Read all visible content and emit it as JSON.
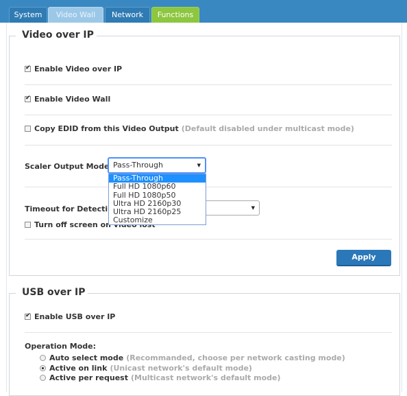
{
  "tabs": [
    {
      "label": "System"
    },
    {
      "label": "Video Wall"
    },
    {
      "label": "Network"
    },
    {
      "label": "Functions"
    }
  ],
  "video_over_ip": {
    "legend": "Video over IP",
    "enable_video_over_ip": {
      "label": "Enable Video over IP",
      "checked": true
    },
    "enable_video_wall": {
      "label": "Enable Video Wall",
      "checked": true
    },
    "copy_edid": {
      "label": "Copy EDID from this Video Output",
      "hint": "(Default disabled under multicast mode)",
      "checked": false
    },
    "scaler": {
      "label": "Scaler Output Mode:",
      "selected": "Pass-Through",
      "options": [
        "Pass-Through",
        "Full HD 1080p60",
        "Full HD 1080p50",
        "Ultra HD 2160p30",
        "Ultra HD 2160p25",
        "Customize"
      ]
    },
    "timeout_label": "Timeout for Detectin",
    "turn_off_screen": {
      "label": "Turn off screen on video lost",
      "checked": false
    },
    "apply_label": "Apply"
  },
  "usb_over_ip": {
    "legend": "USB over IP",
    "enable_usb": {
      "label": "Enable USB over IP",
      "checked": true
    },
    "operation_mode_label": "Operation Mode:",
    "modes": [
      {
        "label": "Auto select mode",
        "hint": "(Recommanded, choose per network casting mode)",
        "selected": false
      },
      {
        "label": "Active on link",
        "hint": "(Unicast network's default mode)",
        "selected": true
      },
      {
        "label": "Active per request",
        "hint": "(Multicast network's default mode)",
        "selected": false
      }
    ]
  },
  "icons": {
    "dropdown_arrow": "caret-down-icon",
    "checkbox_check": "check-icon"
  }
}
